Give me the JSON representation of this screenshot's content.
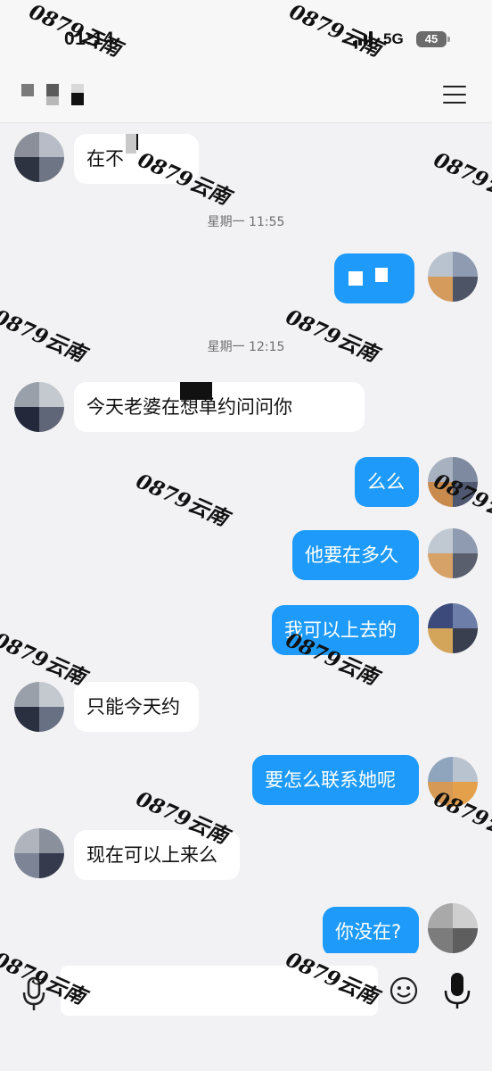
{
  "status_bar": {
    "time": "01:14",
    "network": "5G",
    "battery": "45"
  },
  "header": {
    "contact_name": ""
  },
  "messages": [
    {
      "side": "in",
      "text": "在不"
    },
    {
      "side": "ts",
      "text": "星期一 11:55"
    },
    {
      "side": "out",
      "text": ""
    },
    {
      "side": "ts",
      "text": "星期一 12:15"
    },
    {
      "side": "in",
      "text": "今天老婆在",
      "text_after": "想单约问问你"
    },
    {
      "side": "out",
      "text": "么么"
    },
    {
      "side": "out",
      "text": "他要在多久"
    },
    {
      "side": "out",
      "text": "我可以上去的"
    },
    {
      "side": "in",
      "text": "只能今天约"
    },
    {
      "side": "out",
      "text": "要怎么联系她呢"
    },
    {
      "side": "in",
      "text": "现在可以上来么"
    },
    {
      "side": "out",
      "text": "你没在?"
    }
  ],
  "input": {
    "placeholder": ""
  },
  "watermark": {
    "text": "0879云南"
  },
  "colors": {
    "outgoing_bubble": "#1e9bfa",
    "incoming_bubble": "#ffffff",
    "background": "#f2f2f4"
  },
  "icons": {
    "menu": "hamburger-icon",
    "mic": "microphone-icon",
    "emoji": "smiley-icon",
    "voice": "voice-record-icon",
    "signal": "signal-bars-icon"
  }
}
